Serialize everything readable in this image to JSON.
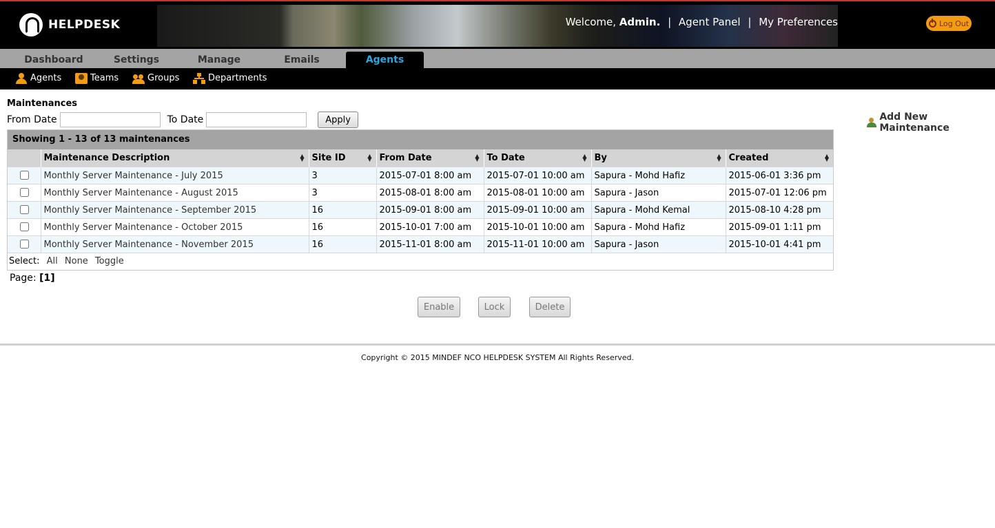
{
  "header": {
    "logo_text": "HELPDESK",
    "welcome_prefix": "Welcome,",
    "welcome_user": "Admin.",
    "links": [
      "Agent Panel",
      "My Preferences"
    ],
    "logout_label": "Log Out",
    "accent_color": "#f39c12",
    "top_border_color": "#c0392b"
  },
  "tabs": [
    "Dashboard",
    "Settings",
    "Manage",
    "Emails",
    "Agents"
  ],
  "active_tab": "Agents",
  "subnav": [
    {
      "label": "Agents",
      "icon": "person-icon"
    },
    {
      "label": "Teams",
      "icon": "team-icon"
    },
    {
      "label": "Groups",
      "icon": "group-icon"
    },
    {
      "label": "Departments",
      "icon": "department-icon"
    }
  ],
  "page": {
    "title": "Maintenances",
    "from_label": "From Date",
    "to_label": "To Date",
    "from_value": "",
    "to_value": "",
    "apply_label": "Apply",
    "add_new_label": "Add New Maintenance"
  },
  "table": {
    "showing": "Showing  1 - 13 of 13 maintenances",
    "columns": [
      "Maintenance Description",
      "Site ID",
      "From Date",
      "To Date",
      "By",
      "Created"
    ],
    "rows": [
      [
        "Monthly Server Maintenance - July 2015",
        "3",
        "2015-07-01 8:00 am",
        "2015-07-01 10:00 am",
        "Sapura - Mohd Hafiz",
        "2015-06-01 3:36 pm"
      ],
      [
        "Monthly Server Maintenance - August 2015",
        "3",
        "2015-08-01 8:00 am",
        "2015-08-01 10:00 am",
        "Sapura - Jason",
        "2015-07-01 12:06 pm"
      ],
      [
        "Monthly Server Maintenance - September 2015",
        "16",
        "2015-09-01 8:00 am",
        "2015-09-01 10:00 am",
        "Sapura - Mohd Kemal",
        "2015-08-10 4:28 pm"
      ],
      [
        "Monthly Server Maintenance - October 2015",
        "16",
        "2015-10-01 7:00 am",
        "2015-10-01 10:00 am",
        "Sapura - Mohd Hafiz",
        "2015-09-01 1:11 pm"
      ],
      [
        "Monthly Server Maintenance - November 2015",
        "16",
        "2015-11-01 8:00 am",
        "2015-11-01 10:00 am",
        "Sapura - Jason",
        "2015-10-01 4:41 pm"
      ]
    ],
    "select_label": "Select:",
    "select_options": [
      "All",
      "None",
      "Toggle"
    ]
  },
  "pager": {
    "label": "Page:",
    "current": "[1]"
  },
  "actions": [
    "Enable",
    "Lock",
    "Delete"
  ],
  "footer": "Copyright © 2015 MINDEF NCO HELPDESK SYSTEM All Rights Reserved."
}
